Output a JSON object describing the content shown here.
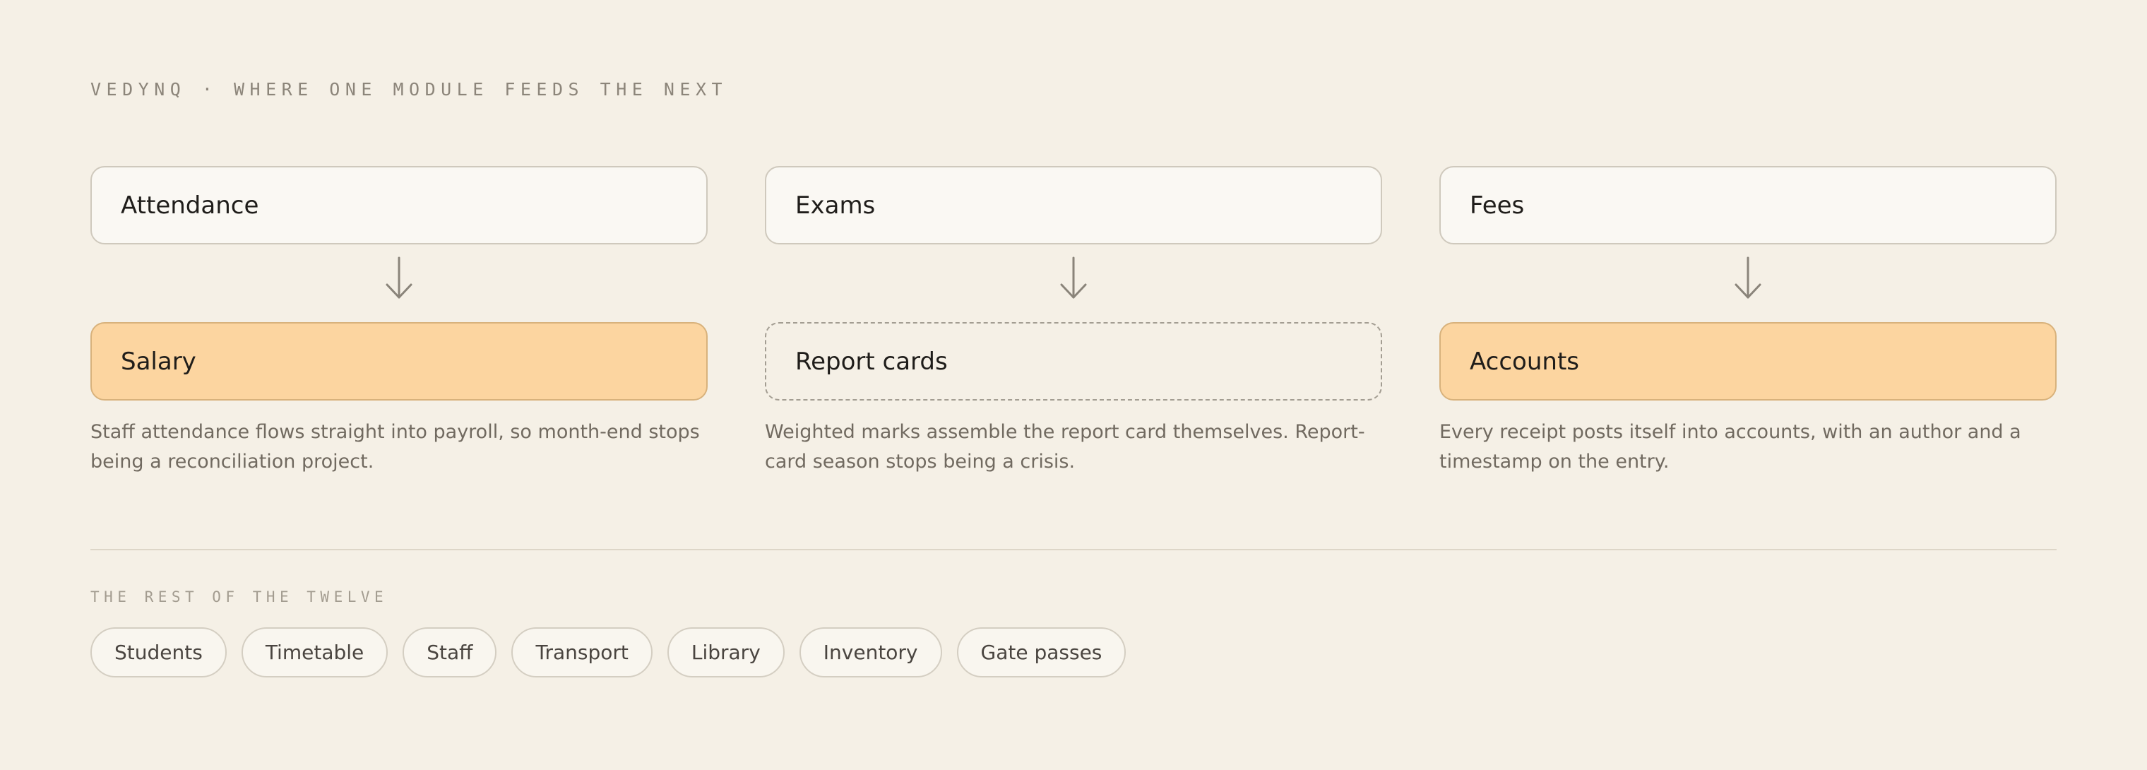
{
  "header": {
    "eyebrow": "VEDYNQ · WHERE ONE MODULE FEEDS THE NEXT"
  },
  "flows": [
    {
      "source": "Attendance",
      "target": "Salary",
      "target_style": "filled",
      "description": "Staff attendance flows straight into payroll, so month-end stops being a reconciliation project."
    },
    {
      "source": "Exams",
      "target": "Report cards",
      "target_style": "dashed",
      "description": "Weighted marks assemble the report card themselves. Report-card season stops being a crisis."
    },
    {
      "source": "Fees",
      "target": "Accounts",
      "target_style": "filled",
      "description": "Every receipt posts itself into accounts, with an author and a timestamp on the entry."
    }
  ],
  "rest": {
    "label": "THE REST OF THE TWELVE",
    "modules": [
      "Students",
      "Timetable",
      "Staff",
      "Transport",
      "Library",
      "Inventory",
      "Gate passes"
    ]
  },
  "colors": {
    "background": "#f5f0e6",
    "filled_target": "#fcd5a0",
    "source_box": "#faf8f3",
    "arrow": "#8a847a"
  },
  "icons": {
    "flow_arrow": "arrow-down-icon"
  }
}
